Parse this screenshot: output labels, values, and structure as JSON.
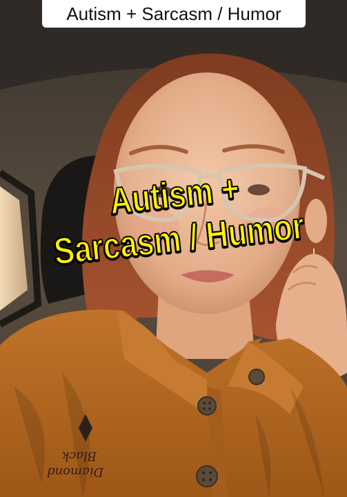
{
  "caption": {
    "top": "Autism + Sarcasm / Humor"
  },
  "overlay": {
    "line1": "Autism +",
    "line2": "Sarcasm / Humor"
  },
  "embroidery": {
    "line1": "Black",
    "line2": "Diamond"
  },
  "colors": {
    "caption_bg": "#ffffff",
    "overlay_text": "#fff200",
    "overlay_outline": "#000000",
    "shirt": "#b4661e",
    "hair": "#9a4a26"
  },
  "icons": [
    "diamond-logo-icon",
    "star-earring-icon"
  ]
}
